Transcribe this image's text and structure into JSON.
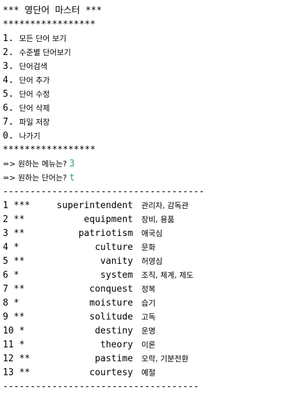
{
  "console": {
    "title": "*** 영단어 마스터 ***",
    "separator_stars": "*****************",
    "menu_items": [
      {
        "num": "1.",
        "label": "모든 단어 보기"
      },
      {
        "num": "2.",
        "label": "수준별 단어보기"
      },
      {
        "num": "3.",
        "label": "단어검색"
      },
      {
        "num": "4.",
        "label": "단어 추가"
      },
      {
        "num": "5.",
        "label": "단어 수정"
      },
      {
        "num": "6.",
        "label": "단어 삭제"
      },
      {
        "num": "7.",
        "label": "파일 저장"
      },
      {
        "num": "0.",
        "label": "나가기"
      }
    ],
    "prompt_menu": "=> 원하는 메뉴는? ",
    "menu_input": "3",
    "prompt_word": "=> 원하는 단어는? ",
    "word_input": "t",
    "separator_dash": "-------------------------------------",
    "separator_dash_end": "------------------------------------",
    "words": [
      {
        "num": "1 ***",
        "eng": "superintendent",
        "kor": "관리자, 감독관"
      },
      {
        "num": "2 **",
        "eng": "equipment",
        "kor": "장비, 용품"
      },
      {
        "num": "3 **",
        "eng": "patriotism",
        "kor": "애국심"
      },
      {
        "num": "4 *",
        "eng": "culture",
        "kor": "문화"
      },
      {
        "num": "5 **",
        "eng": "vanity",
        "kor": "허영심"
      },
      {
        "num": "6 *",
        "eng": "system",
        "kor": "조직, 체계, 제도"
      },
      {
        "num": "7 **",
        "eng": "conquest",
        "kor": "정복"
      },
      {
        "num": "8 *",
        "eng": "moisture",
        "kor": "습기"
      },
      {
        "num": "9 **",
        "eng": "solitude",
        "kor": "고독"
      },
      {
        "num": "10 *",
        "eng": "destiny",
        "kor": "운명"
      },
      {
        "num": "11 *",
        "eng": "theory",
        "kor": "이론"
      },
      {
        "num": "12 **",
        "eng": "pastime",
        "kor": "오락, 기분전환"
      },
      {
        "num": "13 **",
        "eng": "courtesy",
        "kor": "예절"
      }
    ]
  }
}
